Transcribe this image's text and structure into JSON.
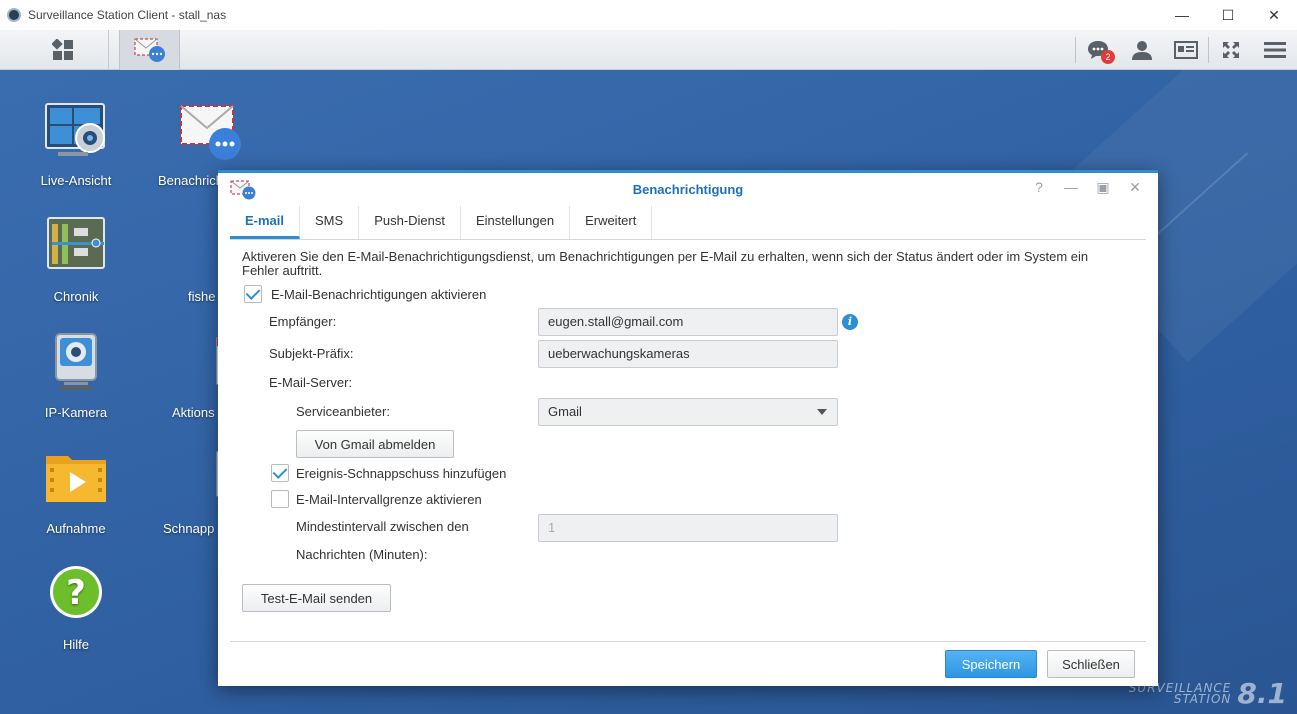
{
  "os": {
    "title": "Surveillance Station Client - stall_nas"
  },
  "toolbar": {
    "notification_count": "2"
  },
  "desktop": {
    "icons": [
      {
        "label": "Live-Ansicht"
      },
      {
        "label": "Benachrichti"
      },
      {
        "label": "Chronik"
      },
      {
        "label": "fishe"
      },
      {
        "label": "IP-Kamera"
      },
      {
        "label": "Aktions"
      },
      {
        "label": "Aufnahme"
      },
      {
        "label": "Schnapp"
      },
      {
        "label": "Hilfe"
      }
    ],
    "brand_line1": "SURVEILLANCE",
    "brand_line2": "STATION",
    "brand_version": "8.1"
  },
  "dialog": {
    "title": "Benachrichtigung",
    "tabs": [
      "E-mail",
      "SMS",
      "Push-Dienst",
      "Einstellungen",
      "Erweitert"
    ],
    "description": "Aktiveren Sie den E-Mail-Benachrichtigungsdienst, um Benachrichtigungen per E-Mail zu erhalten, wenn sich der Status ändert oder im System ein Fehler auftritt.",
    "enable_email_label": "E-Mail-Benachrichtigungen aktivieren",
    "recipient_label": "Empfänger:",
    "recipient_value": "eugen.stall@gmail.com",
    "subject_label": "Subjekt-Präfix:",
    "subject_value": "ueberwachungskameras",
    "server_label": "E-Mail-Server:",
    "provider_label": "Serviceanbieter:",
    "provider_value": "Gmail",
    "signout_button": "Von Gmail abmelden",
    "snapshot_label": "Ereignis-Schnappschuss hinzufügen",
    "interval_enable_label": "E-Mail-Intervallgrenze aktivieren",
    "interval_label_1": "Mindestintervall zwischen den",
    "interval_label_2": "Nachrichten (Minuten):",
    "interval_value": "1",
    "test_button": "Test-E-Mail senden",
    "save_button": "Speichern",
    "close_button": "Schließen",
    "info_glyph": "i"
  }
}
